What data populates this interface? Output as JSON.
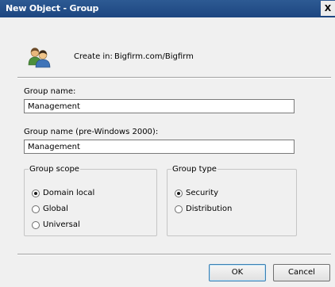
{
  "window": {
    "title": "New Object - Group",
    "close_glyph": "X"
  },
  "header": {
    "icon": "group-users-icon",
    "create_in_label": "Create in:",
    "create_in_value": "Bigfirm.com/Bigfirm"
  },
  "group_name": {
    "label": "Group name:",
    "value": "Management"
  },
  "group_name_pre2000": {
    "label": "Group name (pre-Windows 2000):",
    "value": "Management"
  },
  "group_scope": {
    "legend": "Group scope",
    "options": [
      {
        "label": "Domain local",
        "selected": true
      },
      {
        "label": "Global",
        "selected": false
      },
      {
        "label": "Universal",
        "selected": false
      }
    ]
  },
  "group_type": {
    "legend": "Group type",
    "options": [
      {
        "label": "Security",
        "selected": true
      },
      {
        "label": "Distribution",
        "selected": false
      }
    ]
  },
  "buttons": {
    "ok": "OK",
    "cancel": "Cancel"
  },
  "colors": {
    "titlebar": "#1d4680",
    "dialog_bg": "#f0f0f0"
  }
}
